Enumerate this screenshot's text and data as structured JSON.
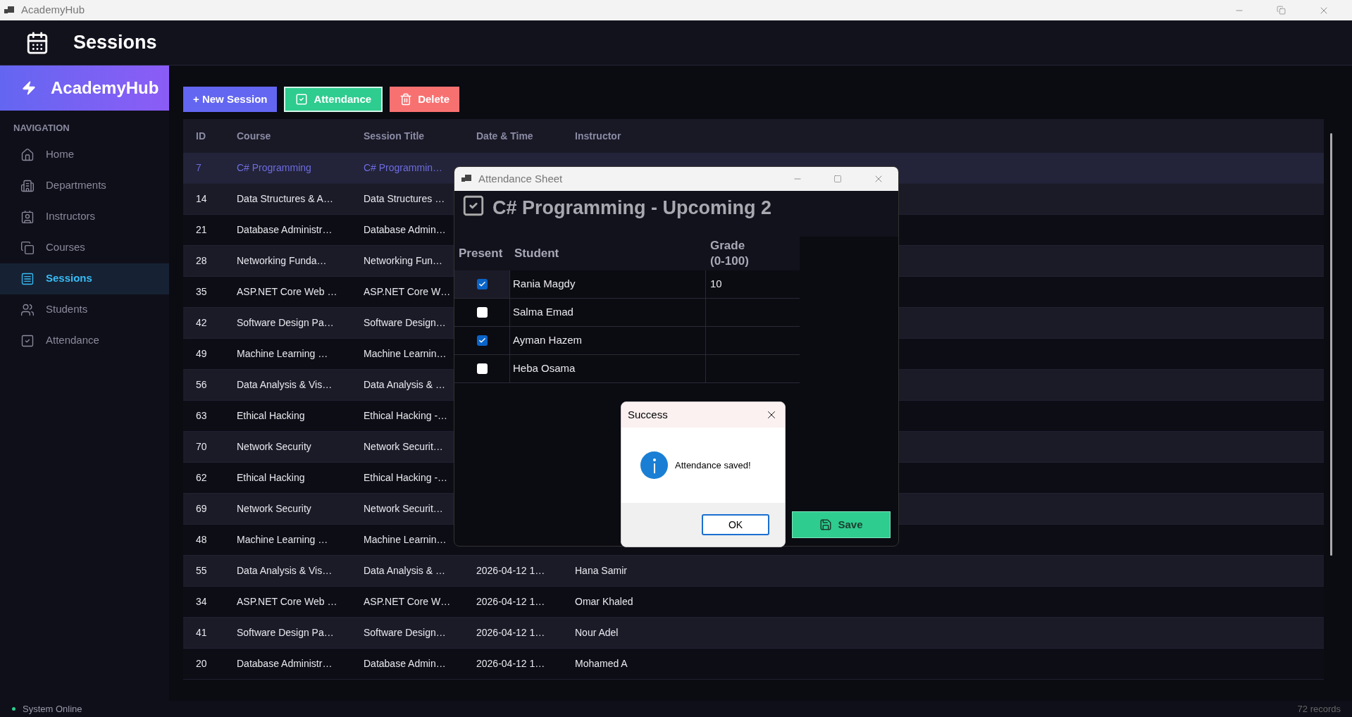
{
  "window": {
    "title": "AcademyHub"
  },
  "header": {
    "title": "Sessions"
  },
  "sidebar": {
    "brand": "AcademyHub",
    "section": "NAVIGATION",
    "items": [
      {
        "label": "Home",
        "kind": "home",
        "selected": false
      },
      {
        "label": "Departments",
        "kind": "building",
        "selected": false
      },
      {
        "label": "Instructors",
        "kind": "instructor",
        "selected": false
      },
      {
        "label": "Courses",
        "kind": "courses",
        "selected": false
      },
      {
        "label": "Sessions",
        "kind": "sessions",
        "selected": true
      },
      {
        "label": "Students",
        "kind": "students",
        "selected": false
      },
      {
        "label": "Attendance",
        "kind": "attendance",
        "selected": false
      }
    ]
  },
  "toolbar": [
    {
      "label": "+ New Session",
      "kind": "new"
    },
    {
      "label": "Attendance",
      "kind": "attendance"
    },
    {
      "label": "Delete",
      "kind": "delete"
    }
  ],
  "table": {
    "columns": [
      "ID",
      "Course",
      "Session Title",
      "Date & Time",
      "Instructor"
    ],
    "rows": [
      {
        "selected": true,
        "cells": [
          "7",
          "C# Programming",
          "C# Programmin…"
        ]
      },
      {
        "selected": false,
        "cells": [
          "14",
          "Data Structures & A…",
          "Data Structures …"
        ]
      },
      {
        "selected": false,
        "cells": [
          "21",
          "Database Administr…",
          "Database Admin…"
        ]
      },
      {
        "selected": false,
        "cells": [
          "28",
          "Networking Funda…",
          "Networking Fun…"
        ]
      },
      {
        "selected": false,
        "cells": [
          "35",
          "ASP.NET Core Web …",
          "ASP.NET Core W…"
        ]
      },
      {
        "selected": false,
        "cells": [
          "42",
          "Software Design Pa…",
          "Software Design…"
        ]
      },
      {
        "selected": false,
        "cells": [
          "49",
          "Machine Learning …",
          "Machine Learnin…"
        ]
      },
      {
        "selected": false,
        "cells": [
          "56",
          "Data Analysis & Vis…",
          "Data Analysis & …"
        ]
      },
      {
        "selected": false,
        "cells": [
          "63",
          "Ethical Hacking",
          "Ethical Hacking -…"
        ]
      },
      {
        "selected": false,
        "cells": [
          "70",
          "Network Security",
          "Network Securit…"
        ]
      },
      {
        "selected": false,
        "cells": [
          "62",
          "Ethical Hacking",
          "Ethical Hacking -…"
        ]
      },
      {
        "selected": false,
        "cells": [
          "69",
          "Network Security",
          "Network Securit…"
        ]
      },
      {
        "selected": false,
        "cells": [
          "48",
          "Machine Learning …",
          "Machine Learnin…"
        ]
      },
      {
        "selected": false,
        "cells": [
          "55",
          "Data Analysis & Vis…",
          "Data Analysis & …",
          "2026-04-12 1…",
          "Hana Samir"
        ]
      },
      {
        "selected": false,
        "cells": [
          "34",
          "ASP.NET Core Web …",
          "ASP.NET Core W…",
          "2026-04-12 1…",
          "Omar Khaled"
        ]
      },
      {
        "selected": false,
        "cells": [
          "41",
          "Software Design Pa…",
          "Software Design…",
          "2026-04-12 1…",
          "Nour Adel"
        ]
      },
      {
        "selected": false,
        "cells": [
          "20",
          "Database Administr…",
          "Database Admin…",
          "2026-04-12 1…",
          "Mohamed A"
        ]
      }
    ]
  },
  "dialog": {
    "title": "Attendance Sheet",
    "heading": "C# Programming - Upcoming 2",
    "columns": [
      "Present",
      "Student",
      "Grade (0-100)"
    ],
    "students": [
      {
        "name": "Rania Magdy",
        "present": true,
        "grade": "10"
      },
      {
        "name": "Salma Emad",
        "present": false
      },
      {
        "name": "Ayman Hazem",
        "present": true
      },
      {
        "name": "Heba Osama",
        "present": false
      }
    ],
    "save_button": "Save"
  },
  "message_box": {
    "title": "Success",
    "message": "Attendance saved!",
    "button": "OK"
  },
  "status_bar": {
    "status": "System Online",
    "records": "72 records"
  }
}
